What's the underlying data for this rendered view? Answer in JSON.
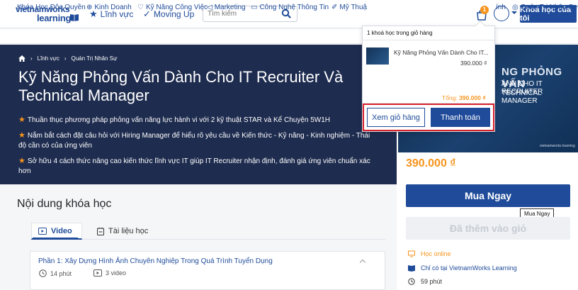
{
  "header": {
    "logo_top": "vietnamworks",
    "logo_bottom": "learning",
    "nav": [
      {
        "label": "Lĩnh vực",
        "icon": "star-icon"
      },
      {
        "label": "Moving Up",
        "icon": "check-icon"
      }
    ],
    "search_placeholder": "Tìm kiếm",
    "cart_count": "1",
    "courses_button": "Khoá học của tôi"
  },
  "categories": [
    "Khóa Học Độc Quyền",
    "Kinh Doanh",
    "Kỹ Năng Công Việc",
    "Marketing",
    "Công Nghệ Thông Tin",
    "Mỹ Thuậ",
    "ính",
    "Quản Trị Nhân Sự"
  ],
  "breadcrumb": [
    "Lĩnh vực",
    "Quản Trị Nhân Sự"
  ],
  "course": {
    "title": "Kỹ Năng Phỏng Vấn Dành Cho IT Recruiter Và Technical Manager",
    "bullets": [
      "Thuần thục phương pháp phỏng vấn năng lực hành vi với 2 kỹ thuật STAR và Kể Chuyện 5W1H",
      "Nắm bắt cách đặt câu hỏi với Hiring Manager để hiểu rõ yêu cầu về Kiến thức - Kỹ năng - Kinh nghiệm - Thái độ cần có của ứng viên",
      "Sở hữu 4 cách thức nâng cao kiến thức lĩnh vực IT giúp IT Recruiter nhận định, đánh giá ứng viên chuẩn xác hơn"
    ],
    "image_text": [
      "NG PHỎNG VẤN",
      "ÀNH CHO IT RECRUITER",
      "TECHNICAL MANAGER"
    ],
    "image_watermark": "vietnamworks learning",
    "price": "390.000 ₫",
    "buy_now": "Mua Ngay",
    "buy_tooltip": "Mua Ngay",
    "added_to_cart": "Đã thêm vào giỏ",
    "features": [
      {
        "label": "Học online",
        "icon": "online-icon"
      },
      {
        "label": "Chỉ có tại VietnamWorks Learning",
        "icon": "book-icon"
      },
      {
        "label": "59 phút",
        "icon": "clock-icon"
      }
    ]
  },
  "content": {
    "section_title": "Nội dung khóa học",
    "tabs": [
      {
        "label": "Video",
        "icon": "video-icon",
        "active": true
      },
      {
        "label": "Tài liệu học",
        "icon": "document-icon",
        "active": false
      }
    ],
    "parts": [
      {
        "title": "Phần 1: Xây Dựng Hình Ảnh Chuyên Nghiệp Trong Quá Trình Tuyển Dụng",
        "duration": "14 phút",
        "videos": "3 video"
      }
    ]
  },
  "cart": {
    "header": "1 khoá học trong giỏ hàng",
    "item_title": "Kỹ Năng Phỏng Vấn Dành Cho IT...",
    "item_price": "390.000 ₫",
    "total_label": "Tổng:",
    "total_value": "390.000 ₫",
    "view_cart": "Xem giỏ hàng",
    "checkout": "Thanh toán"
  },
  "colors": {
    "primary": "#1f4b9a",
    "accent": "#f7941d",
    "hero_bg": "#1e2c4f",
    "highlight": "#d9232d"
  }
}
